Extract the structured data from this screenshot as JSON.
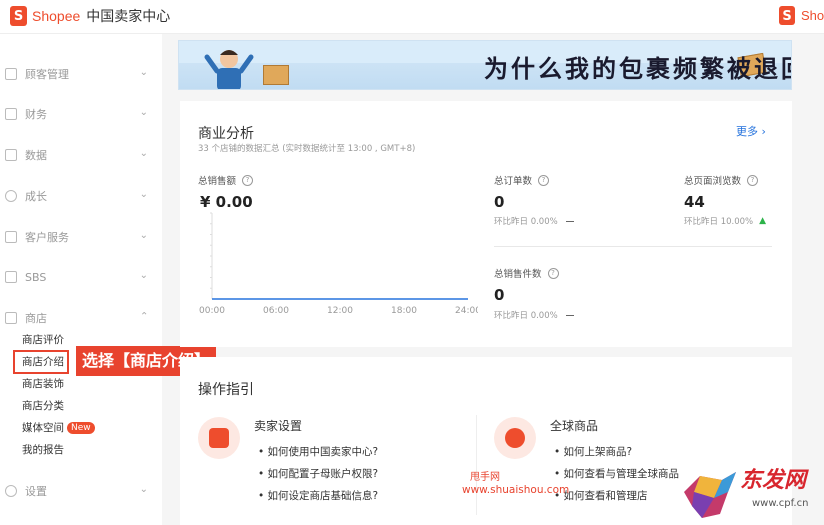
{
  "header": {
    "brand": "Shopee",
    "brand_sub": "中国卖家中心",
    "brand_right": "Sho"
  },
  "sidebar": {
    "items": [
      {
        "label": "顾客管理",
        "icon": "customer-icon"
      },
      {
        "label": "财务",
        "icon": "wallet-icon"
      },
      {
        "label": "数据",
        "icon": "chart-icon"
      },
      {
        "label": "成长",
        "icon": "growth-icon"
      },
      {
        "label": "客户服务",
        "icon": "service-icon"
      },
      {
        "label": "SBS",
        "icon": "sbs-icon"
      },
      {
        "label": "商店",
        "icon": "shop-icon"
      },
      {
        "label": "设置",
        "icon": "gear-icon"
      }
    ],
    "shop_sub": [
      "商店评价",
      "商店介绍",
      "商店装饰",
      "商店分类",
      "媒体空间",
      "我的报告"
    ],
    "new_badge": "New"
  },
  "callout": "选择【商店介绍】",
  "banner": {
    "text": "为什么我的包裹频繁被退回?"
  },
  "analysis": {
    "title": "商业分析",
    "subtitle": "33 个店铺的数据汇总 (实时数据统计至 13:00 , GMT+8)",
    "more": "更多",
    "metrics": {
      "sales": {
        "label": "总销售额",
        "value": "¥ 0.00"
      },
      "orders": {
        "label": "总订单数",
        "value": "0",
        "compare": "环比昨日 0.00%"
      },
      "views": {
        "label": "总页面浏览数",
        "value": "44",
        "compare": "环比昨日 10.00%"
      },
      "items": {
        "label": "总销售件数",
        "value": "0",
        "compare": "环比昨日 0.00%"
      }
    }
  },
  "chart_data": {
    "type": "line",
    "x": [
      "00:00",
      "06:00",
      "12:00",
      "18:00",
      "24:00"
    ],
    "series": [
      {
        "values": [
          0,
          0,
          0,
          0,
          0
        ]
      }
    ],
    "ylabel": "",
    "xlabel": ""
  },
  "guide": {
    "title": "操作指引",
    "columns": [
      {
        "title": "卖家设置",
        "icon": "bag-icon",
        "links": [
          "如何使用中国卖家中心?",
          "如何配置子母账户权限?",
          "如何设定商店基础信息?"
        ]
      },
      {
        "title": "全球商品",
        "icon": "gear-icon",
        "links": [
          "如何上架商品?",
          "如何查看与管理全球商品",
          "如何查看和管理店"
        ]
      }
    ]
  },
  "watermark": {
    "site1": "甩手网",
    "url1": "www.shuaishou.com",
    "site2": "东发网",
    "url2": "www.cpf.cn"
  },
  "colors": {
    "brand": "#ee4d2d",
    "link": "#2673dd",
    "up": "#2db34a"
  }
}
